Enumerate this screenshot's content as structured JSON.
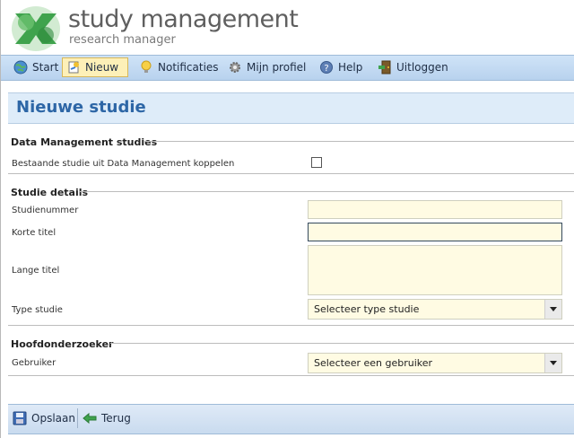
{
  "brand": {
    "title": "study management",
    "subtitle": "research manager",
    "accent": "#3fa34d"
  },
  "nav": {
    "items": [
      {
        "label": "Start",
        "icon": "globe-icon"
      },
      {
        "label": "Nieuw",
        "icon": "new-document-icon",
        "active": true
      },
      {
        "label": "Notificaties",
        "icon": "lightbulb-icon"
      },
      {
        "label": "Mijn profiel",
        "icon": "gear-icon"
      },
      {
        "label": "Help",
        "icon": "help-icon"
      },
      {
        "label": "Uitloggen",
        "icon": "logout-door-icon"
      }
    ]
  },
  "page": {
    "title": "Nieuwe studie"
  },
  "sections": {
    "data_management": {
      "title": "Data Management studies",
      "link_label": "Bestaande studie uit Data Management koppelen",
      "link_checked": false
    },
    "details": {
      "title": "Studie details",
      "study_number": {
        "label": "Studienummer",
        "value": ""
      },
      "short_title": {
        "label": "Korte titel",
        "value": ""
      },
      "long_title": {
        "label": "Lange titel",
        "value": ""
      },
      "study_type": {
        "label": "Type studie",
        "selected": "Selecteer type studie"
      }
    },
    "investigator": {
      "title": "Hoofdonderzoeker",
      "user": {
        "label": "Gebruiker",
        "selected": "Selecteer een gebruiker"
      }
    }
  },
  "footer": {
    "save_label": "Opslaan",
    "back_label": "Terug"
  }
}
